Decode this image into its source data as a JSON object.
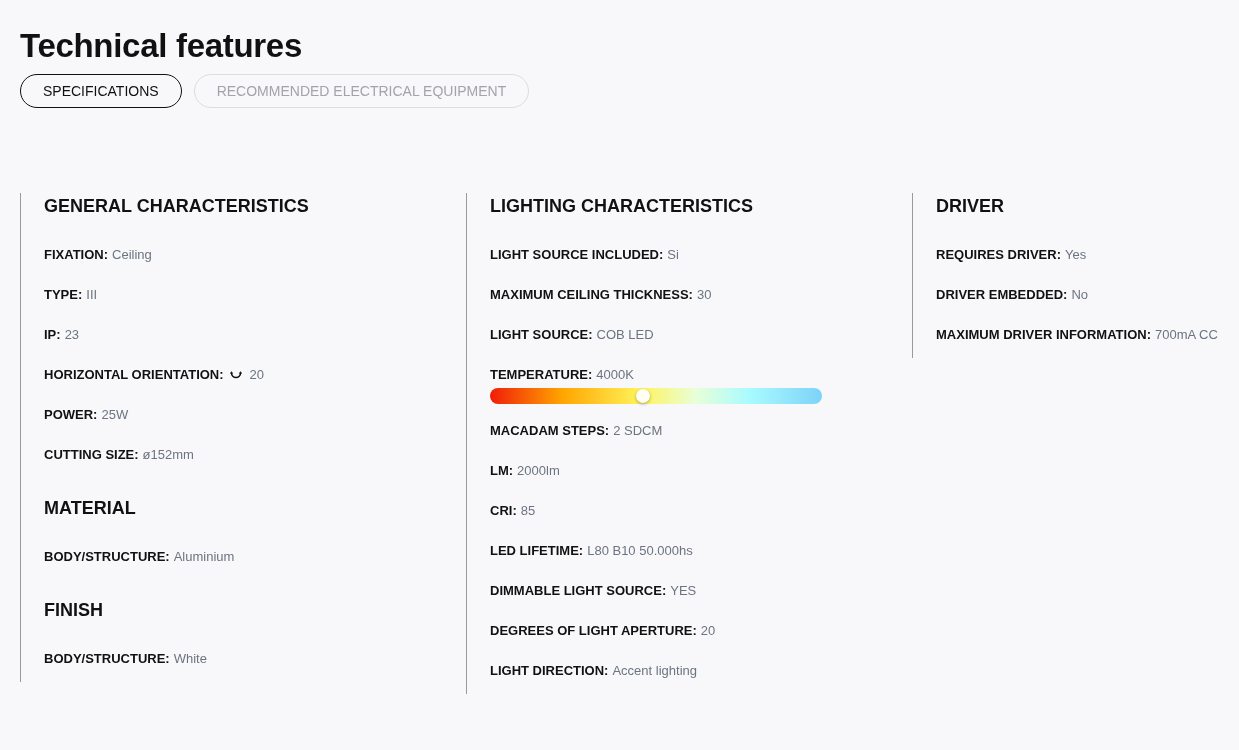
{
  "title": "Technical features",
  "tabs": [
    {
      "label": "SPECIFICATIONS",
      "selected": true
    },
    {
      "label": "RECOMMENDED ELECTRICAL EQUIPMENT",
      "selected": false
    }
  ],
  "columns": [
    {
      "sections": [
        {
          "heading": "GENERAL CHARACTERISTICS",
          "items": [
            {
              "kind": "text",
              "label": "FIXATION:",
              "value": "Ceiling"
            },
            {
              "kind": "text",
              "label": "TYPE:",
              "value": "III"
            },
            {
              "kind": "text",
              "label": "IP:",
              "value": "23"
            },
            {
              "kind": "rotation",
              "label": "HORIZONTAL ORIENTATION:",
              "value": "20"
            },
            {
              "kind": "text",
              "label": "POWER:",
              "value": "25W"
            },
            {
              "kind": "text",
              "label": "CUTTING SIZE:",
              "value": "ø152mm"
            }
          ]
        },
        {
          "heading": "MATERIAL",
          "items": [
            {
              "kind": "text",
              "label": "BODY/STRUCTURE:",
              "value": "Aluminium"
            }
          ]
        },
        {
          "heading": "FINISH",
          "items": [
            {
              "kind": "text",
              "label": "BODY/STRUCTURE:",
              "value": "White"
            }
          ]
        }
      ]
    },
    {
      "sections": [
        {
          "heading": "LIGHTING CHARACTERISTICS",
          "items": [
            {
              "kind": "text",
              "label": "LIGHT SOURCE INCLUDED:",
              "value": "Si"
            },
            {
              "kind": "text",
              "label": "MAXIMUM CEILING THICKNESS:",
              "value": "30"
            },
            {
              "kind": "text",
              "label": "LIGHT SOURCE:",
              "value": "COB LED"
            },
            {
              "kind": "temperature",
              "label": "TEMPERATURE:",
              "value": "4000K",
              "level": 0.46
            },
            {
              "kind": "text",
              "label": "MACADAM STEPS:",
              "value": "2 SDCM"
            },
            {
              "kind": "text",
              "label": "LM:",
              "value": "2000lm"
            },
            {
              "kind": "text",
              "label": "CRI:",
              "value": "85"
            },
            {
              "kind": "text",
              "label": "LED LIFETIME:",
              "value": "L80 B10 50.000hs"
            },
            {
              "kind": "text",
              "label": "DIMMABLE LIGHT SOURCE:",
              "value": "YES"
            },
            {
              "kind": "text",
              "label": "DEGREES OF LIGHT APERTURE:",
              "value": "20"
            },
            {
              "kind": "text",
              "label": "LIGHT DIRECTION:",
              "value": "Accent lighting"
            }
          ]
        }
      ]
    },
    {
      "sections": [
        {
          "heading": "DRIVER",
          "items": [
            {
              "kind": "text",
              "label": "REQUIRES DRIVER:",
              "value": "Yes"
            },
            {
              "kind": "text",
              "label": "DRIVER EMBEDDED:",
              "value": "No"
            },
            {
              "kind": "text",
              "label": "MAXIMUM DRIVER INFORMATION:",
              "value": "700mA CC"
            }
          ]
        }
      ]
    }
  ]
}
